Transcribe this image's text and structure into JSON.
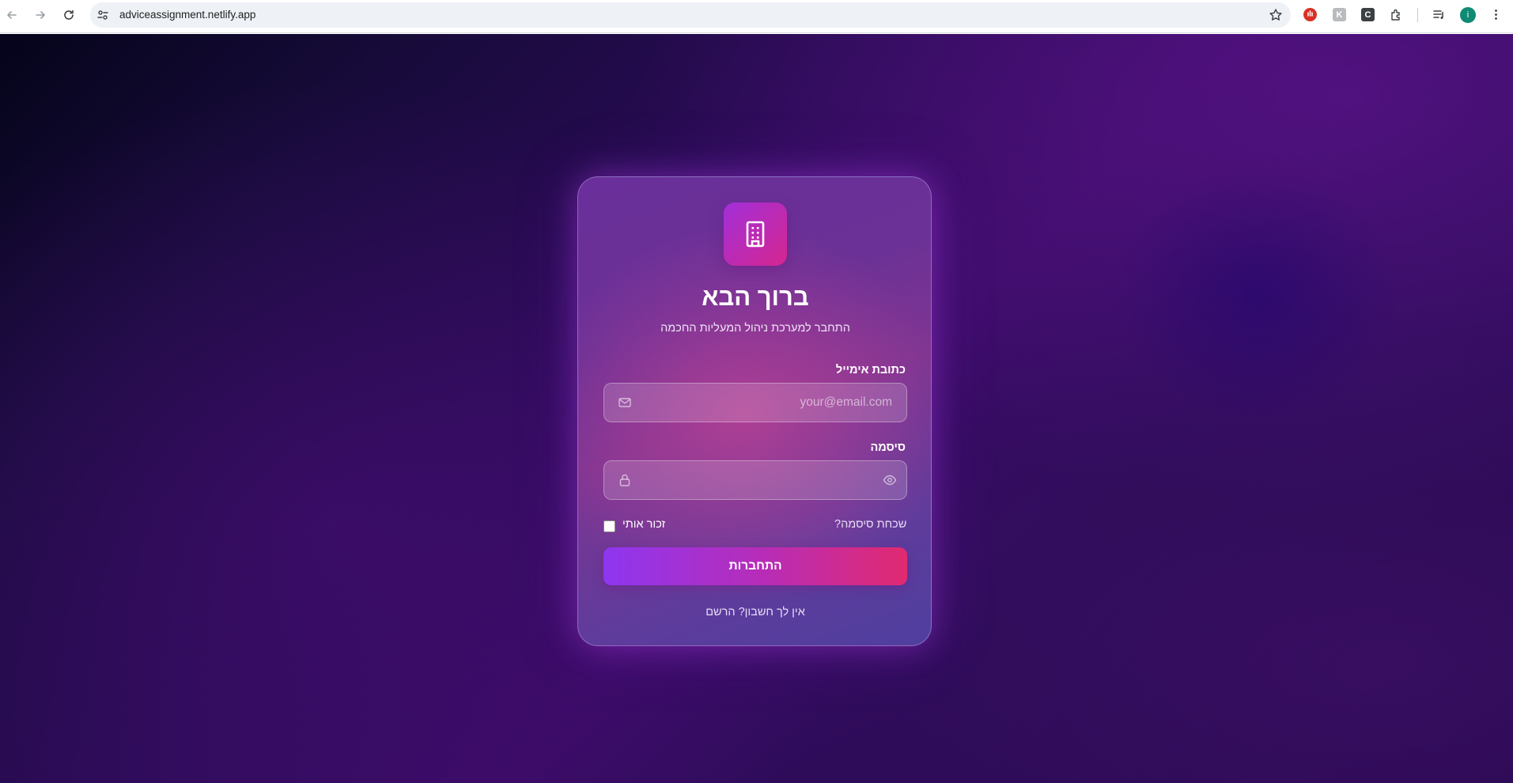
{
  "browser": {
    "url": "adviceassignment.netlify.app",
    "profile_initial": "i",
    "extensions": [
      "stop-sign-extension-icon",
      "k-extension-icon",
      "c-extension-icon",
      "puzzle-extensions-icon",
      "media-queue-icon"
    ]
  },
  "login": {
    "title": "ברוך הבא",
    "subtitle": "התחבר למערכת ניהול המעליות החכמה",
    "email_label": "כתובת אימייל",
    "email_placeholder": "your@email.com",
    "password_label": "סיסמה",
    "password_placeholder": "",
    "forgot_password": "שכחת סיסמה?",
    "remember_me": "זכור אותי",
    "submit": "התחברות",
    "signup": "אין לך חשבון? הרשם"
  },
  "colors": {
    "accent_start": "#8e36f0",
    "accent_end": "#e12a70",
    "logo_gradient": [
      "#a22fd9",
      "#d5268f"
    ],
    "background_dark": "#05041a",
    "background_purple": "#3a0c66"
  }
}
